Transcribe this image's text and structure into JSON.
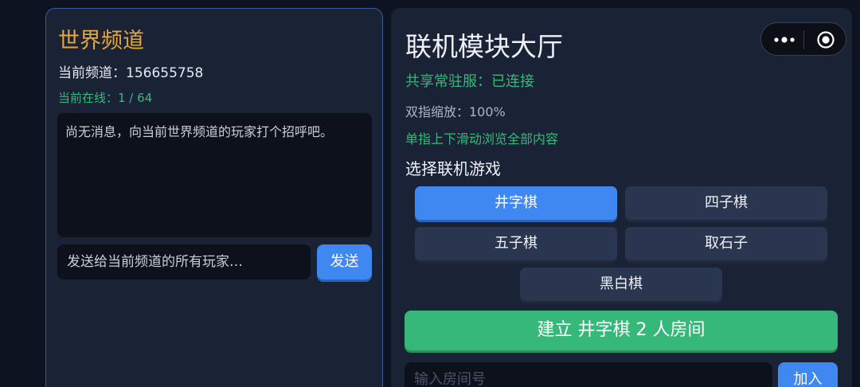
{
  "world_channel": {
    "title": "世界频道",
    "channel_line": "当前频道：156655758",
    "online_line": "当前在线：1 / 64",
    "message_text": "尚无消息，向当前世界频道的玩家打个招呼吧。",
    "input_placeholder": "发送给当前频道的所有玩家…",
    "send_label": "发送"
  },
  "lobby": {
    "title": "联机模块大厅",
    "server_status": "共享常驻服：已连接",
    "zoom_line": "双指缩放：100%",
    "hint": "单指上下滑动浏览全部内容",
    "select_label": "选择联机游戏",
    "games": [
      {
        "label": "井字棋",
        "selected": true
      },
      {
        "label": "四子棋",
        "selected": false
      },
      {
        "label": "五子棋",
        "selected": false
      },
      {
        "label": "取石子",
        "selected": false
      },
      {
        "label": "黑白棋",
        "selected": false
      }
    ],
    "create_label": "建立 井字棋 2 人房间",
    "room_placeholder": "输入房间号",
    "join_label": "加入"
  },
  "capsule": {
    "more_icon": "more-dots-icon",
    "close_icon": "target-close-icon"
  },
  "colors": {
    "background": "#0d1320",
    "panel": "#1a2236",
    "accent_blue": "#3f88f2",
    "accent_green": "#37b87b",
    "title_orange": "#e5a63c"
  }
}
